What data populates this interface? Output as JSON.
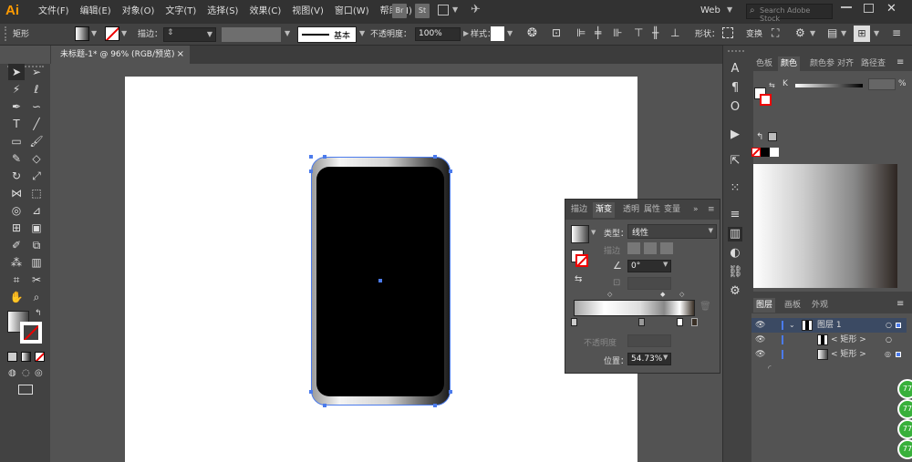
{
  "app": {
    "logo": "Ai",
    "workspace": "Web",
    "search_placeholder": "Search Adobe Stock"
  },
  "menu": [
    "文件(F)",
    "编辑(E)",
    "对象(O)",
    "文字(T)",
    "选择(S)",
    "效果(C)",
    "视图(V)",
    "窗口(W)",
    "帮助(H)"
  ],
  "appbar": {
    "br": "Br",
    "st": "St"
  },
  "control": {
    "object_type": "矩形",
    "stroke_label": "描边：",
    "stroke_style": "基本",
    "opacity_label": "不透明度：",
    "opacity_value": "100%",
    "style_label": "样式：",
    "shape_label": "形状：",
    "transform_label": "变换"
  },
  "document": {
    "tab_title": "未标题-1* @ 96% (RGB/预览)",
    "close": "×"
  },
  "right_panel": {
    "tabs": [
      "色板",
      "颜色",
      "颜色参",
      "对齐",
      "路径查"
    ],
    "active_tab": "颜色",
    "k_label": "K",
    "k_unit": "%",
    "layers_tabs": [
      "图层",
      "画板",
      "外观"
    ],
    "layers": [
      {
        "name": "图层 1",
        "selected": true
      },
      {
        "name": "< 矩形 >",
        "selected": false
      },
      {
        "name": "< 矩形 >",
        "selected": false
      }
    ]
  },
  "gradient_panel": {
    "tabs": [
      "描边",
      "渐变",
      "透明",
      "属性",
      "变量"
    ],
    "active_tab": "渐变",
    "type_label": "类型：",
    "type_value": "线性",
    "stroke_label": "描边",
    "angle_value": "0°",
    "opacity_label": "不透明度",
    "position_label": "位置：",
    "position_value": "54.73%"
  },
  "colors": {
    "accent": "#4b7bec",
    "menubar": "#323232",
    "panel": "#424242",
    "workspace": "#535353",
    "badge_green": "#38b03a"
  },
  "badges": [
    "77",
    "77",
    "77",
    "77"
  ]
}
